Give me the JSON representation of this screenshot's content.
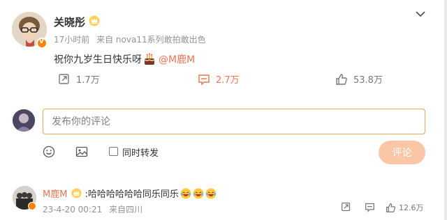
{
  "post": {
    "username": "关晓彤",
    "time": "17小时前",
    "source": "来自 nova11系列敢拍敢出色",
    "content_text": "祝你九岁生日快乐呀",
    "mention": "@M鹿M",
    "actions": {
      "repost_count": "1.7万",
      "comment_count": "2.7万",
      "like_count": "53.8万"
    },
    "icons": [
      "crown-icon",
      "chevron-down-icon",
      "cake-icon",
      "repost-icon",
      "comment-icon",
      "like-icon"
    ],
    "colors": {
      "accent": "#eb7350",
      "badge": "#ff8200"
    }
  },
  "compose": {
    "placeholder": "发布你的评论",
    "repost_label": "同时转发",
    "submit_label": "评论",
    "icons": [
      "emoji-icon",
      "image-icon"
    ]
  },
  "comment": {
    "username": "M鹿M",
    "text": ":哈哈哈哈哈哈同乐同乐",
    "time": "23-4-20 00:21",
    "location": "来自四川",
    "like_count": "12.6万",
    "icons": [
      "laugh-emoji-icon",
      "share-icon",
      "reply-icon",
      "like-icon"
    ]
  }
}
